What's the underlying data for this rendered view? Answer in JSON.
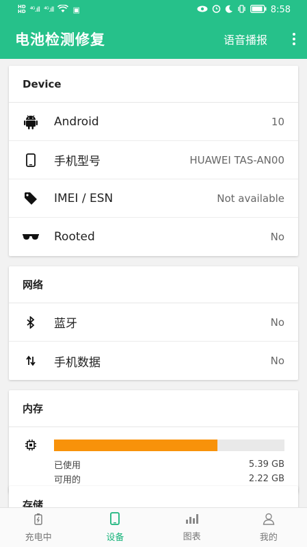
{
  "status_bar": {
    "left_icons": [
      "HD",
      "4G",
      "4G",
      "wifi"
    ],
    "sig1": "⁴ᴳ.ıll",
    "sig2": "⁴ᴳ.ıll",
    "time": "8:58"
  },
  "app_bar": {
    "title": "电池检测修复",
    "voice_button": "语音播报"
  },
  "device_card": {
    "title": "Device",
    "rows": [
      {
        "label": "Android",
        "value": "10",
        "icon": "android-icon"
      },
      {
        "label": "手机型号",
        "value": "HUAWEI TAS-AN00",
        "icon": "phone-icon"
      },
      {
        "label": "IMEI / ESN",
        "value": "Not available",
        "icon": "tag-icon"
      },
      {
        "label": "Rooted",
        "value": "No",
        "icon": "sunglasses-icon"
      }
    ]
  },
  "network_card": {
    "title": "网络",
    "rows": [
      {
        "label": "蓝牙",
        "value": "No",
        "icon": "bluetooth-icon"
      },
      {
        "label": "手机数据",
        "value": "No",
        "icon": "data-arrows-icon"
      }
    ]
  },
  "memory_card": {
    "title": "内存",
    "used_fraction": 0.71,
    "used_label": "已使用",
    "used_value": "5.39 GB",
    "available_label": "可用的",
    "available_value": "2.22 GB",
    "bar_color": "#f8920a"
  },
  "storage_card": {
    "title": "存储"
  },
  "bottom_nav": {
    "tabs": [
      {
        "label": "充电中",
        "icon": "battery-charging-icon"
      },
      {
        "label": "设备",
        "icon": "phone-device-icon",
        "active": true
      },
      {
        "label": "图表",
        "icon": "bar-chart-icon"
      },
      {
        "label": "我的",
        "icon": "person-icon"
      }
    ]
  },
  "colors": {
    "primary": "#26c18a",
    "active_tab": "#19b47b"
  }
}
